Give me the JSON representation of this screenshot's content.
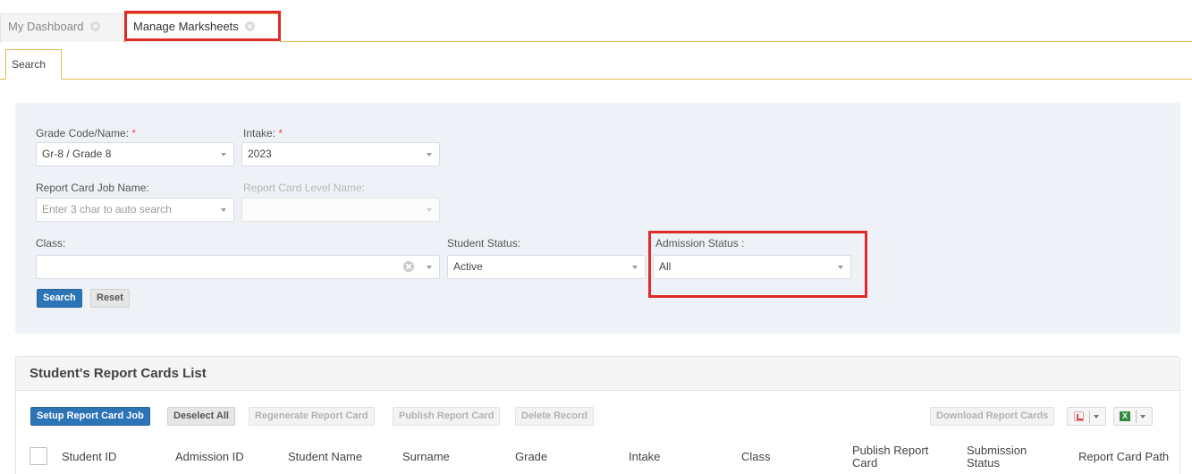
{
  "top_tabs": [
    {
      "label": "My Dashboard"
    },
    {
      "label": "Manage Marksheets"
    }
  ],
  "sub_tab": {
    "label": "Search"
  },
  "form": {
    "grade": {
      "label": "Grade Code/Name:",
      "required": "*",
      "value": "Gr-8 / Grade 8"
    },
    "intake": {
      "label": "Intake:",
      "required": "*",
      "value": "2023"
    },
    "report_card_job": {
      "label": "Report Card Job Name:",
      "placeholder": "Enter 3 char to auto search"
    },
    "report_card_level": {
      "label": "Report Card Level Name:",
      "value": ""
    },
    "class": {
      "label": "Class:",
      "value": ""
    },
    "student_status": {
      "label": "Student Status:",
      "value": "Active"
    },
    "admission_status": {
      "label": "Admission Status :",
      "value": "All"
    },
    "search_button": "Search",
    "reset_button": "Reset"
  },
  "list": {
    "title": "Student's Report Cards List",
    "toolbar": {
      "setup": "Setup Report Card Job",
      "deselect": "Deselect All",
      "regenerate": "Regenerate Report Card",
      "publish": "Publish Report Card",
      "delete": "Delete Record",
      "download": "Download Report Cards"
    },
    "export_icons": [
      "pdf-icon",
      "excel-icon"
    ],
    "columns": [
      {
        "line1": "Student ID",
        "line2": ""
      },
      {
        "line1": "Admission ID",
        "line2": ""
      },
      {
        "line1": "Student Name",
        "line2": ""
      },
      {
        "line1": "Surname",
        "line2": ""
      },
      {
        "line1": "Grade",
        "line2": ""
      },
      {
        "line1": "Intake",
        "line2": ""
      },
      {
        "line1": "Class",
        "line2": ""
      },
      {
        "line1": "Publish Report",
        "line2": "Card"
      },
      {
        "line1": "Submission",
        "line2": "Status"
      },
      {
        "line1": "Report Card Path",
        "line2": ""
      }
    ]
  },
  "colors": {
    "accent": "#e6b94f",
    "primary_button": "#2d74b6",
    "highlight": "#e02a2a",
    "panel_bg": "#eef2f7"
  }
}
